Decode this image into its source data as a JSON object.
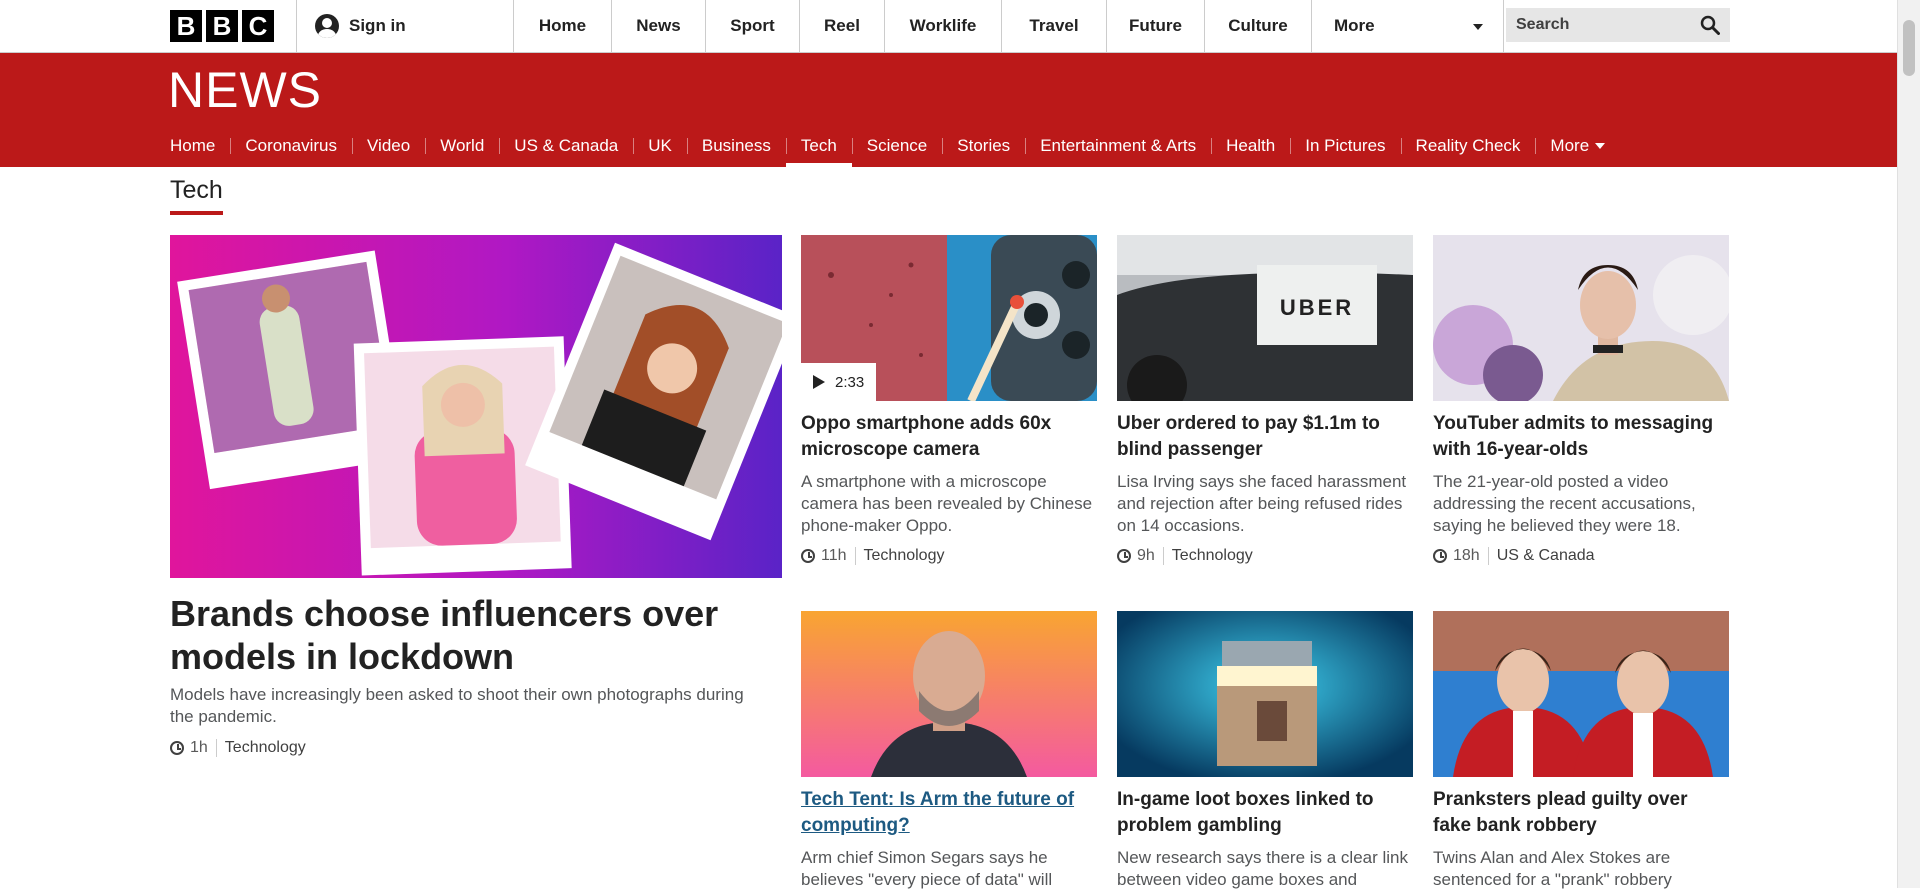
{
  "topbar": {
    "logo_letters": [
      "B",
      "B",
      "C"
    ],
    "signin_label": "Sign in",
    "nav": [
      "Home",
      "News",
      "Sport",
      "Reel",
      "Worklife",
      "Travel",
      "Future",
      "Culture"
    ],
    "more_label": "More",
    "search_placeholder": "Search"
  },
  "news": {
    "logo": "NEWS",
    "nav": [
      "Home",
      "Coronavirus",
      "Video",
      "World",
      "US & Canada",
      "UK",
      "Business",
      "Tech",
      "Science",
      "Stories",
      "Entertainment & Arts",
      "Health",
      "In Pictures",
      "Reality Check"
    ],
    "active_item": "Tech",
    "more_label": "More",
    "brand_color": "#bb1919"
  },
  "section_title": "Tech",
  "lead": {
    "title": "Brands choose influencers over models in lockdown",
    "summary": "Models have increasingly been asked to shoot their own photographs during the pandemic.",
    "time": "1h",
    "category": "Technology"
  },
  "cards": [
    {
      "title": "Oppo smartphone adds 60x microscope camera",
      "summary": "A smartphone with a microscope camera has been revealed by Chinese phone-maker Oppo.",
      "time": "11h",
      "category": "Technology",
      "video_duration": "2:33"
    },
    {
      "title": "Uber ordered to pay $1.1m to blind passenger",
      "summary": "Lisa Irving says she faced harassment and rejection after being refused rides on 14 occasions.",
      "time": "9h",
      "category": "Technology",
      "image_text": "UBER"
    },
    {
      "title": "YouTuber admits to messaging with 16-year-olds",
      "summary": "The 21-year-old posted a video addressing the recent accusations, saying he believed they were 18.",
      "time": "18h",
      "category": "US & Canada"
    },
    {
      "title": "Tech Tent: Is Arm the future of computing?",
      "summary": "Arm chief Simon Segars says he believes \"every piece of data\" will"
    },
    {
      "title": "In-game loot boxes linked to problem gambling",
      "summary": "New research says there is a clear link between video game boxes and"
    },
    {
      "title": "Pranksters plead guilty over fake bank robbery",
      "summary": "Twins Alan and Alex Stokes are sentenced for a \"prank\" robbery"
    }
  ]
}
